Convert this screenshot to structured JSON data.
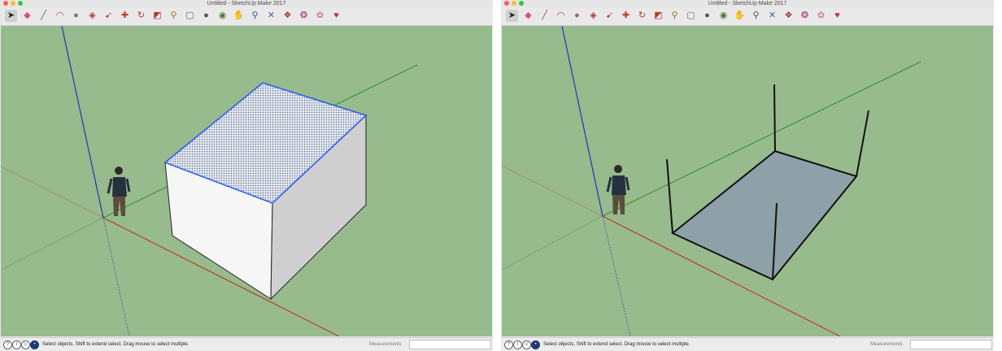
{
  "windows": [
    {
      "title": "Untitled - SketchUp Make 2017",
      "status": "Select objects. Shift to extend select. Drag mouse to select multiple.",
      "measurements_label": "Measurements",
      "measurements_value": "",
      "model_state": "solid box with selected top face"
    },
    {
      "title": "Untitled - SketchUp Make 2017",
      "status": "Select objects. Shift to extend select. Drag mouse to select multiple.",
      "measurements_label": "Measurements",
      "measurements_value": "",
      "model_state": "base face with four vertical edge lines"
    }
  ],
  "toolbar_tools": [
    {
      "name": "select-tool-icon",
      "glyph": "➤",
      "color": "#222222",
      "active": true
    },
    {
      "name": "eraser-tool-icon",
      "glyph": "◆",
      "color": "#d9507a"
    },
    {
      "name": "pencil-line-tool-icon",
      "glyph": "╱",
      "color": "#8a5a2a"
    },
    {
      "name": "arc-tool-icon",
      "glyph": "◠",
      "color": "#c0392b"
    },
    {
      "name": "shapes-tool-icon",
      "glyph": "●",
      "color": "#8b6b6b"
    },
    {
      "name": "push-pull-tool-icon",
      "glyph": "◈",
      "color": "#b03a2e"
    },
    {
      "name": "follow-me-tool-icon",
      "glyph": "➹",
      "color": "#c0392b"
    },
    {
      "name": "move-tool-icon",
      "glyph": "✚",
      "color": "#c0392b"
    },
    {
      "name": "rotate-tool-icon",
      "glyph": "↻",
      "color": "#c0392b"
    },
    {
      "name": "scale-tool-icon",
      "glyph": "◩",
      "color": "#b03a2e"
    },
    {
      "name": "tape-measure-tool-icon",
      "glyph": "⚲",
      "color": "#a0702a"
    },
    {
      "name": "text-tool-icon",
      "glyph": "▢",
      "color": "#666666"
    },
    {
      "name": "paint-bucket-tool-icon",
      "glyph": "●",
      "color": "#6b4a3a"
    },
    {
      "name": "orbit-tool-icon",
      "glyph": "◉",
      "color": "#4a7a3a"
    },
    {
      "name": "pan-tool-icon",
      "glyph": "✋",
      "color": "#c8a060"
    },
    {
      "name": "zoom-tool-icon",
      "glyph": "⚲",
      "color": "#4a4a8a"
    },
    {
      "name": "zoom-extents-tool-icon",
      "glyph": "✕",
      "color": "#3a6aa0"
    },
    {
      "name": "warehouse-tool-icon",
      "glyph": "❖",
      "color": "#a03a3a"
    },
    {
      "name": "extension-warehouse-tool-icon",
      "glyph": "❂",
      "color": "#a0307a"
    },
    {
      "name": "layout-tool-icon",
      "glyph": "✿",
      "color": "#d07aa0"
    },
    {
      "name": "ruby-tool-icon",
      "glyph": "♥",
      "color": "#c0304a"
    }
  ],
  "status_icons": [
    {
      "name": "geolocation-icon",
      "glyph": "?"
    },
    {
      "name": "credits-icon",
      "glyph": "i"
    },
    {
      "name": "user-icon",
      "glyph": "☺"
    },
    {
      "name": "sketchup-info-icon",
      "glyph": "•",
      "dark": true
    }
  ],
  "colors": {
    "viewport_bg": "#97bb8c",
    "axis_red": "#c0392b",
    "axis_green": "#2e8b2e",
    "axis_blue": "#2233bb",
    "selection_blue": "#2c5ef0",
    "face_grey": "#8ea0a8"
  }
}
